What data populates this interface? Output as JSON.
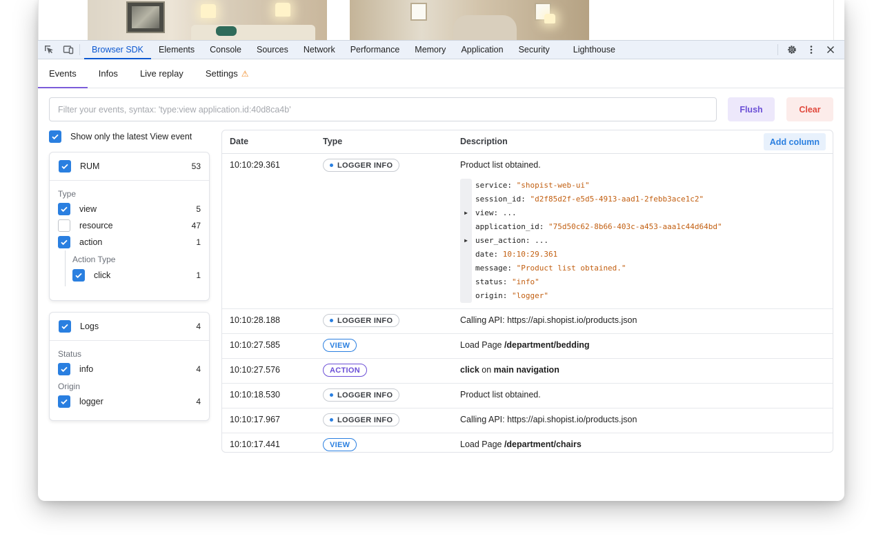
{
  "devtools_tabs": [
    {
      "label": "Browser SDK",
      "active": true
    },
    {
      "label": "Elements"
    },
    {
      "label": "Console"
    },
    {
      "label": "Sources"
    },
    {
      "label": "Network"
    },
    {
      "label": "Performance"
    },
    {
      "label": "Memory"
    },
    {
      "label": "Application"
    },
    {
      "label": "Security"
    },
    {
      "label": "Lighthouse"
    }
  ],
  "toolbar_icons": [
    "inspect-element-icon",
    "device-toolbar-icon",
    "settings-gear-icon",
    "more-options-icon",
    "close-icon"
  ],
  "subtabs": [
    {
      "label": "Events",
      "active": true
    },
    {
      "label": "Infos"
    },
    {
      "label": "Live replay"
    },
    {
      "label": "Settings",
      "warning_icon": "⚠"
    }
  ],
  "filter": {
    "placeholder": "Filter your events, syntax: 'type:view application.id:40d8ca4b'",
    "value": "",
    "flush_label": "Flush",
    "clear_label": "Clear"
  },
  "latest_view": {
    "label": "Show only the latest View event",
    "checked": true
  },
  "rum": {
    "label": "RUM",
    "count": "53",
    "checked": true,
    "type_title": "Type",
    "types": [
      {
        "label": "view",
        "count": "5",
        "checked": true
      },
      {
        "label": "resource",
        "count": "47",
        "checked": false
      },
      {
        "label": "action",
        "count": "1",
        "checked": true
      }
    ],
    "action_type_title": "Action Type",
    "action_types": [
      {
        "label": "click",
        "count": "1",
        "checked": true
      }
    ]
  },
  "logs": {
    "label": "Logs",
    "count": "4",
    "checked": true,
    "status_title": "Status",
    "statuses": [
      {
        "label": "info",
        "count": "4",
        "checked": true
      }
    ],
    "origin_title": "Origin",
    "origins": [
      {
        "label": "logger",
        "count": "4",
        "checked": true
      }
    ]
  },
  "table": {
    "headers": {
      "date": "Date",
      "type": "Type",
      "description": "Description"
    },
    "add_column_label": "Add column",
    "rows": [
      {
        "date": "10:10:29.361",
        "type": "LOGGER INFO",
        "desc": "Product list obtained.",
        "expanded": true
      },
      {
        "date": "10:10:28.188",
        "type": "LOGGER INFO",
        "desc": "Calling API: https://api.shopist.io/products.json"
      },
      {
        "date": "10:10:27.585",
        "type": "VIEW",
        "desc_prefix": "Load Page ",
        "desc_bold": "/department/bedding"
      },
      {
        "date": "10:10:27.576",
        "type": "ACTION",
        "desc_bold1": "click",
        "desc_mid": " on ",
        "desc_bold2": "main navigation"
      },
      {
        "date": "10:10:18.530",
        "type": "LOGGER INFO",
        "desc": "Product list obtained."
      },
      {
        "date": "10:10:17.967",
        "type": "LOGGER INFO",
        "desc": "Calling API: https://api.shopist.io/products.json"
      },
      {
        "date": "10:10:17.441",
        "type": "VIEW",
        "desc_prefix": "Load Page ",
        "desc_bold": "/department/chairs"
      }
    ],
    "expanded_json": [
      {
        "key": "service: ",
        "value": "\"shopist-web-ui\""
      },
      {
        "key": "session_id: ",
        "value": "\"d2f85d2f-e5d5-4913-aad1-2febb3ace1c2\""
      },
      {
        "key": "view: ...",
        "value": "",
        "collapsed": true
      },
      {
        "key": "application_id: ",
        "value": "\"75d50c62-8b66-403c-a453-aaa1c44d64bd\""
      },
      {
        "key": "user_action: ...",
        "value": "",
        "collapsed": true
      },
      {
        "key": "date: ",
        "value": "10:10:29.361"
      },
      {
        "key": "message: ",
        "value": "\"Product list obtained.\""
      },
      {
        "key": "status: ",
        "value": "\"info\""
      },
      {
        "key": "origin: ",
        "value": "\"logger\""
      }
    ]
  },
  "colors": {
    "accent": "#2a7fe0",
    "tab_active": "#0b57d0",
    "subtab_underline": "#7b5cd9",
    "string": "#c25f11",
    "flush": "#6b4fd6",
    "clear": "#e0483c"
  }
}
